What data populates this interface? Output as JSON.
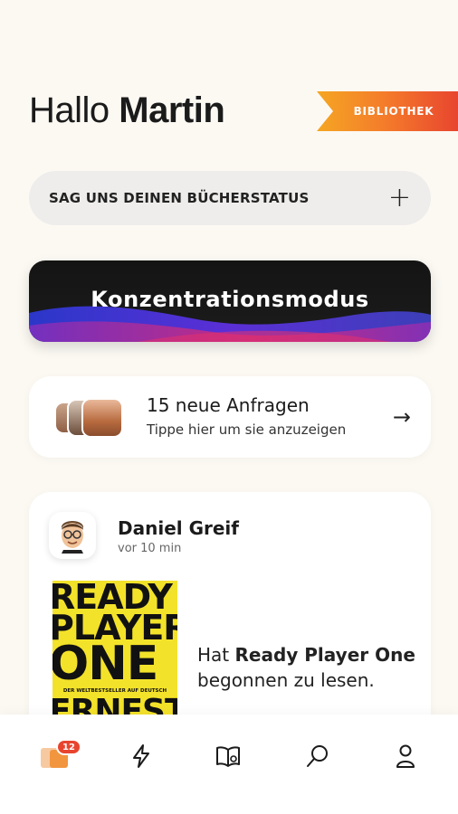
{
  "header": {
    "greeting_prefix": "Hallo",
    "user_name": "Martin",
    "library_label": "BIBLIOTHEK"
  },
  "status_pill": {
    "label": "SAG UNS DEINEN BÜCHERSTATUS",
    "action_glyph": "+"
  },
  "focus_mode": {
    "title": "Konzentrationsmodus"
  },
  "requests": {
    "title": "15 neue Anfragen",
    "subtitle": "Tippe hier um sie anzuzeigen",
    "arrow_glyph": "→"
  },
  "feed": {
    "author": "Daniel Greif",
    "time": "vor 10 min",
    "text_prefix": "Hat",
    "book_title": "Ready Player One",
    "text_suffix": "begonnen zu lesen.",
    "cover": {
      "line1": "READY",
      "line2": "PLAYER",
      "line3": "ONE",
      "strip": "DER WELTBESTSELLER AUF DEUTSCH",
      "line4": "ERNEST"
    }
  },
  "tabbar": {
    "items": [
      "home-icon",
      "lightning-icon",
      "book-icon",
      "search-icon",
      "profile-icon"
    ],
    "home_badge": "12"
  },
  "colors": {
    "background": "#fcf9f3",
    "accent_orange": "#f47a2b",
    "accent_red": "#e8452f",
    "cover_yellow": "#f3e22a"
  }
}
